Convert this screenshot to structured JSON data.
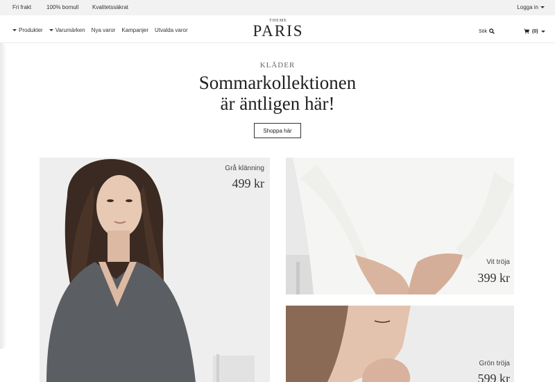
{
  "topbar": {
    "usps": [
      "Fri frakt",
      "100% bomull",
      "Kvalitetssäkrat"
    ],
    "login_label": "Logga in"
  },
  "header": {
    "nav": [
      {
        "label": "Produkter",
        "has_dropdown": true
      },
      {
        "label": "Varumärken",
        "has_dropdown": true
      },
      {
        "label": "Nya varor",
        "has_dropdown": false
      },
      {
        "label": "Kampanjer",
        "has_dropdown": false
      },
      {
        "label": "Utvalda varor",
        "has_dropdown": false
      }
    ],
    "logo_small": "THEME",
    "logo_main": "PARIS",
    "search_label": "Sök",
    "cart_count": "(0)"
  },
  "hero": {
    "kicker": "KLÄDER",
    "title_line1": "Sommarkollektionen",
    "title_line2": "är äntligen här!",
    "button_label": "Shoppa här"
  },
  "products": [
    {
      "name": "Grå klänning",
      "price": "499 kr"
    },
    {
      "name": "Vit tröja",
      "price": "399 kr"
    },
    {
      "name": "Grön tröja",
      "price": "599 kr"
    }
  ],
  "icons": {
    "search": "search-icon",
    "cart": "cart-icon",
    "dropdown": "chevron-down-icon"
  },
  "colors": {
    "topbar_bg": "#f2f2f2",
    "text": "#222222",
    "button_border": "#333333"
  }
}
